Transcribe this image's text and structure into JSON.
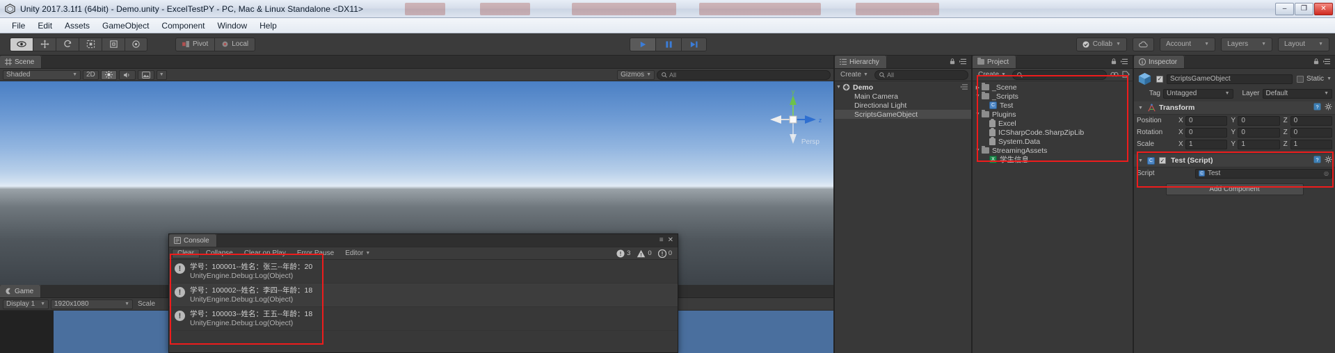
{
  "window": {
    "title": "Unity 2017.3.1f1 (64bit) - Demo.unity - ExcelTestPY - PC, Mac & Linux Standalone <DX11>",
    "app_icon": "unity-logo-icon",
    "minimize": "–",
    "maximize": "❐",
    "close": "✕"
  },
  "menubar": {
    "items": [
      "File",
      "Edit",
      "Assets",
      "GameObject",
      "Component",
      "Window",
      "Help"
    ]
  },
  "toolbar": {
    "tools": [
      {
        "name": "hand-tool",
        "glyph": "✋",
        "active": true
      },
      {
        "name": "move-tool",
        "glyph": "✥",
        "active": false
      },
      {
        "name": "rotate-tool",
        "glyph": "⟳",
        "active": false
      },
      {
        "name": "scale-tool",
        "glyph": "⤢",
        "active": false
      },
      {
        "name": "rect-tool",
        "glyph": "▣",
        "active": false
      },
      {
        "name": "transform-tool",
        "glyph": "◉",
        "active": false
      }
    ],
    "pivot_label": "Pivot",
    "handle_label": "Local",
    "play_label": "▶",
    "pause_label": "❙❙",
    "step_label": "▶❙",
    "collab_label": "Collab",
    "cloud_label": "☁",
    "account_label": "Account",
    "layers_label": "Layers",
    "layout_label": "Layout",
    "accent_blue": "#3b7dd8"
  },
  "scene_panel": {
    "tab_label": "Scene",
    "draw_mode": "Shaded",
    "mode_2d": "2D",
    "lighting_icon": "sun-icon",
    "audio_icon": "speaker-icon",
    "effects_icon": "image-icon",
    "gizmos_label": "Gizmos",
    "search_placeholder": "All",
    "persp_label": "Persp",
    "axis_y": "y",
    "axis_z": "z"
  },
  "game_panel": {
    "tab_label": "Game",
    "display_label": "Display 1",
    "resolution": "1920x1080",
    "scale_label": "Scale"
  },
  "hierarchy": {
    "tab_label": "Hierarchy",
    "create_label": "Create",
    "search_placeholder": "All",
    "items": [
      {
        "label": "Demo",
        "depth": 0,
        "icon": "unity-scene-icon",
        "expanded": true,
        "bold": true
      },
      {
        "label": "Main Camera",
        "depth": 1,
        "icon": "none",
        "expanded": false,
        "bold": false
      },
      {
        "label": "Directional Light",
        "depth": 1,
        "icon": "none",
        "expanded": false,
        "bold": false
      },
      {
        "label": "ScriptsGameObject",
        "depth": 1,
        "icon": "none",
        "expanded": false,
        "bold": false
      }
    ]
  },
  "project": {
    "tab_label": "Project",
    "create_label": "Create",
    "search_placeholder": "",
    "items": [
      {
        "label": "_Scene",
        "depth": 0,
        "icon": "folder-icon",
        "expanded": false
      },
      {
        "label": "_Scripts",
        "depth": 0,
        "icon": "folder-icon",
        "expanded": true
      },
      {
        "label": "Test",
        "depth": 1,
        "icon": "csharp-icon",
        "expanded": false
      },
      {
        "label": "Plugins",
        "depth": 0,
        "icon": "folder-icon",
        "expanded": true
      },
      {
        "label": "Excel",
        "depth": 1,
        "icon": "dll-icon",
        "expanded": false
      },
      {
        "label": "ICSharpCode.SharpZipLib",
        "depth": 1,
        "icon": "dll-icon",
        "expanded": false
      },
      {
        "label": "System.Data",
        "depth": 1,
        "icon": "dll-icon",
        "expanded": false
      },
      {
        "label": "StreamingAssets",
        "depth": 0,
        "icon": "folder-icon",
        "expanded": true
      },
      {
        "label": "学生信息",
        "depth": 1,
        "icon": "excel-icon",
        "expanded": false
      }
    ]
  },
  "inspector": {
    "tab_label": "Inspector",
    "object_name": "ScriptsGameObject",
    "object_enabled": "✓",
    "static_label": "Static",
    "tag_label": "Tag",
    "tag_value": "Untagged",
    "layer_label": "Layer",
    "layer_value": "Default",
    "transform": {
      "title": "Transform",
      "rows": [
        {
          "label": "Position",
          "x": "0",
          "y": "0",
          "z": "0"
        },
        {
          "label": "Rotation",
          "x": "0",
          "y": "0",
          "z": "0"
        },
        {
          "label": "Scale",
          "x": "1",
          "y": "1",
          "z": "1"
        }
      ],
      "axis_x": "X",
      "axis_y": "Y",
      "axis_z": "Z"
    },
    "script_component": {
      "title": "Test (Script)",
      "enabled": "✓",
      "field_label": "Script",
      "field_value": "Test"
    },
    "add_component_label": "Add Component"
  },
  "console": {
    "tab_label": "Console",
    "buttons": [
      "Clear",
      "Collapse",
      "Clear on Play",
      "Error Pause",
      "Editor"
    ],
    "counts": {
      "logs": "3",
      "warnings": "0",
      "errors": "0"
    },
    "entries": [
      {
        "icon": "info-icon",
        "message": "学号：100001--姓名：张三--年龄：20",
        "stack": "UnityEngine.Debug:Log(Object)"
      },
      {
        "icon": "info-icon",
        "message": "学号：100002--姓名：李四--年龄：18",
        "stack": "UnityEngine.Debug:Log(Object)"
      },
      {
        "icon": "info-icon",
        "message": "学号：100003--姓名：王五--年龄：18",
        "stack": "UnityEngine.Debug:Log(Object)"
      }
    ],
    "close_icon": "✕",
    "menu_icon": "≡"
  },
  "annotations": {
    "color": "#ee1c1c",
    "boxes": [
      "project-assets-box",
      "inspector-script-box",
      "console-log-box"
    ]
  }
}
